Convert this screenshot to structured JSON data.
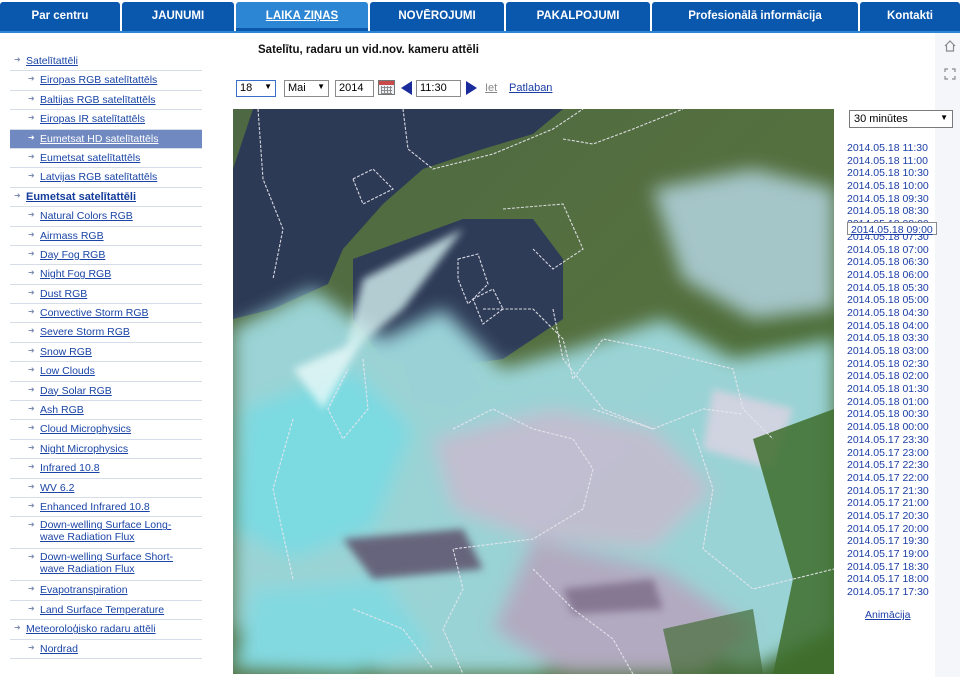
{
  "nav": {
    "tabs": [
      {
        "label": "Par centru"
      },
      {
        "label": "JAUNUMI"
      },
      {
        "label": "LAIKA ZIŅAS"
      },
      {
        "label": "NOVĒROJUMI"
      },
      {
        "label": "PAKALPOJUMI"
      },
      {
        "label": "Profesionālā informācija"
      },
      {
        "label": "Kontakti"
      }
    ],
    "active_index": 2
  },
  "colors": {
    "nav_bg": "#0a57ae",
    "nav_active": "#2c86d4",
    "menu_highlight": "#7089c0",
    "link": "#1a45a6",
    "arrow": "#1a2c9c"
  },
  "menu": {
    "items": [
      {
        "label": "Satelītattēli"
      },
      {
        "label": "Eiropas RGB satelītattēls"
      },
      {
        "label": "Baltijas RGB satelītattēls"
      },
      {
        "label": "Eiropas IR satelītattēls"
      },
      {
        "label": "Eumetsat HD satelītattēls"
      },
      {
        "label": "Eumetsat satelītattēls"
      },
      {
        "label": "Latvijas RGB satelītattēls"
      },
      {
        "label": "Eumetsat satelītattēli"
      },
      {
        "label": "Natural Colors RGB"
      },
      {
        "label": "Airmass RGB"
      },
      {
        "label": "Day Fog RGB"
      },
      {
        "label": "Night Fog RGB"
      },
      {
        "label": "Dust RGB"
      },
      {
        "label": "Convective Storm RGB"
      },
      {
        "label": "Severe Storm RGB"
      },
      {
        "label": "Snow RGB"
      },
      {
        "label": "Low Clouds"
      },
      {
        "label": "Day Solar RGB"
      },
      {
        "label": "Ash RGB"
      },
      {
        "label": "Cloud Microphysics"
      },
      {
        "label": "Night Microphysics"
      },
      {
        "label": "Infrared 10.8"
      },
      {
        "label": "WV 6.2"
      },
      {
        "label": "Enhanced Infrared 10.8"
      },
      {
        "label": "Down-welling Surface Long-wave Radiation Flux"
      },
      {
        "label": "Down-welling Surface Short-wave Radiation Flux"
      },
      {
        "label": "Evapotranspiration"
      },
      {
        "label": "Land Surface Temperature"
      },
      {
        "label": "Meteoroloģisko radaru attēli"
      },
      {
        "label": "Nordrad"
      }
    ],
    "highlighted_index": 4
  },
  "page": {
    "title": "Satelītu, radaru un vid.nov. kameru attēli"
  },
  "controls": {
    "day": "18",
    "month": "Mai",
    "year": "2014",
    "time": "11:30",
    "go_label": "Iet",
    "now_label": "Patlaban"
  },
  "interval": {
    "selected": "30 minūtes"
  },
  "timestamps": {
    "items": [
      "2014.05.18 11:30",
      "2014.05.18 11:00",
      "2014.05.18 10:30",
      "2014.05.18 10:00",
      "2014.05.18 09:30",
      "2014.05.18 09:00",
      "2014.05.18 08:30",
      "2014.05.18 08:00",
      "2014.05.18 07:30",
      "2014.05.18 07:00",
      "2014.05.18 06:30",
      "2014.05.18 06:00",
      "2014.05.18 05:30",
      "2014.05.18 05:00",
      "2014.05.18 04:30",
      "2014.05.18 04:00",
      "2014.05.18 03:30",
      "2014.05.18 03:00",
      "2014.05.18 02:30",
      "2014.05.18 02:00",
      "2014.05.18 01:30",
      "2014.05.18 01:00",
      "2014.05.18 00:30",
      "2014.05.18 00:00",
      "2014.05.17 23:30",
      "2014.05.17 23:00",
      "2014.05.17 22:30",
      "2014.05.17 22:00",
      "2014.05.17 21:30",
      "2014.05.17 21:00",
      "2014.05.17 20:30",
      "2014.05.17 20:00",
      "2014.05.17 19:30",
      "2014.05.17 19:00",
      "2014.05.17 18:30",
      "2014.05.17 18:00",
      "2014.05.17 17:30"
    ],
    "selected_index": 5,
    "animation_label": "Animācija"
  },
  "icons": {
    "home": "home-icon",
    "fullscreen": "fullscreen-icon",
    "calendar": "calendar-icon",
    "prev": "triangle-left-icon",
    "next": "triangle-right-icon",
    "menu_arrow": "arrow-right-icon"
  }
}
